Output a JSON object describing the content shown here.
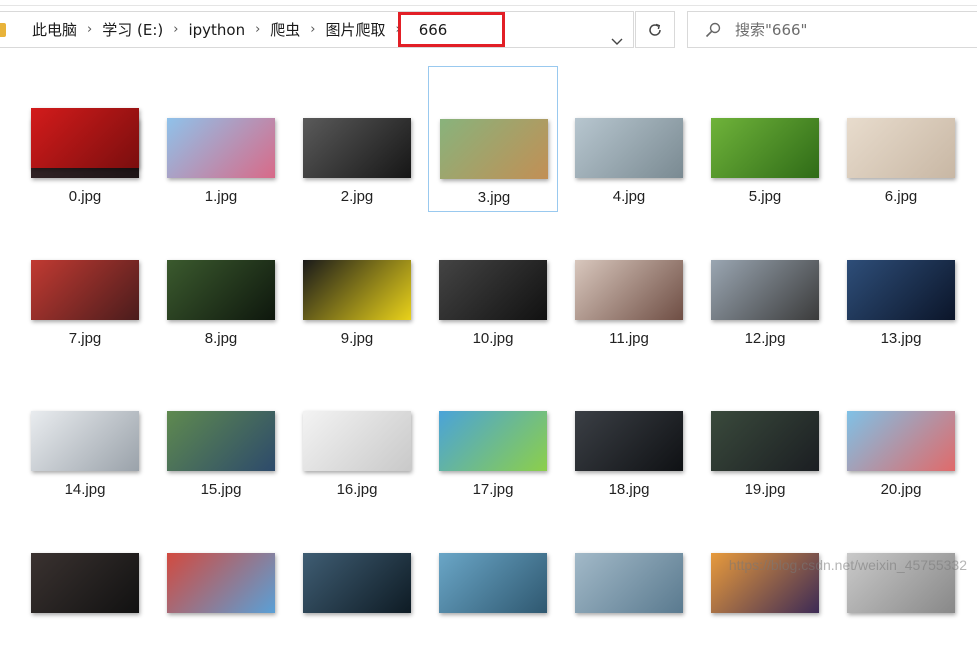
{
  "breadcrumb": {
    "items": [
      "此电脑",
      "学习 (E:)",
      "ipython",
      "爬虫",
      "图片爬取",
      "666"
    ]
  },
  "search": {
    "placeholder": "搜索\"666\""
  },
  "files": [
    {
      "name": "0.jpg",
      "colors": [
        "#3a2a2c",
        "#1d1416"
      ]
    },
    {
      "name": "1.jpg",
      "colors": [
        "#8fc2ea",
        "#d86a88"
      ]
    },
    {
      "name": "2.jpg",
      "colors": [
        "#5a5a5a",
        "#161616"
      ]
    },
    {
      "name": "3.jpg",
      "colors": [
        "#88b37c",
        "#c28f55"
      ]
    },
    {
      "name": "4.jpg",
      "colors": [
        "#b7c6cf",
        "#7a8a92"
      ]
    },
    {
      "name": "5.jpg",
      "colors": [
        "#6fb33a",
        "#2f6b17"
      ]
    },
    {
      "name": "6.jpg",
      "colors": [
        "#e8dccd",
        "#c8b7a4"
      ]
    },
    {
      "name": "7.jpg",
      "colors": [
        "#c13a32",
        "#4a1c1c"
      ]
    },
    {
      "name": "8.jpg",
      "colors": [
        "#3b5a2e",
        "#0e170d"
      ]
    },
    {
      "name": "9.jpg",
      "colors": [
        "#1a1a1a",
        "#e9d21a"
      ]
    },
    {
      "name": "10.jpg",
      "colors": [
        "#444",
        "#111"
      ]
    },
    {
      "name": "11.jpg",
      "colors": [
        "#d8c7bd",
        "#6f4e44"
      ]
    },
    {
      "name": "12.jpg",
      "colors": [
        "#9aa6b2",
        "#3b3b3b"
      ]
    },
    {
      "name": "13.jpg",
      "colors": [
        "#2e4e79",
        "#0b1529"
      ]
    },
    {
      "name": "14.jpg",
      "colors": [
        "#e9ecef",
        "#9aa2aa"
      ]
    },
    {
      "name": "15.jpg",
      "colors": [
        "#5f8a4f",
        "#2d4a6b"
      ]
    },
    {
      "name": "16.jpg",
      "colors": [
        "#f3f3f3",
        "#c9c9c9"
      ]
    },
    {
      "name": "17.jpg",
      "colors": [
        "#4aa3d9",
        "#8ccf4a"
      ]
    },
    {
      "name": "18.jpg",
      "colors": [
        "#3b3f45",
        "#0f1114"
      ]
    },
    {
      "name": "19.jpg",
      "colors": [
        "#3a4a3c",
        "#1b1e22"
      ]
    },
    {
      "name": "20.jpg",
      "colors": [
        "#7fc1e6",
        "#e06a6a"
      ]
    },
    {
      "name": "",
      "colors": [
        "#3a3230",
        "#111"
      ]
    },
    {
      "name": "",
      "colors": [
        "#d24a3f",
        "#5aa0d6"
      ]
    },
    {
      "name": "",
      "colors": [
        "#3f5d73",
        "#0e1b24"
      ]
    },
    {
      "name": "",
      "colors": [
        "#6aa6c7",
        "#2f5870"
      ]
    },
    {
      "name": "",
      "colors": [
        "#a2b9c8",
        "#5a7a8f"
      ]
    },
    {
      "name": "",
      "colors": [
        "#e79a3c",
        "#3d2a55"
      ]
    },
    {
      "name": "",
      "colors": [
        "#c9c9c9",
        "#888"
      ]
    },
    {
      "name": "",
      "colors": [
        "#d31b1b",
        "#7a0e0e"
      ]
    }
  ],
  "selected_file": "3.jpg",
  "watermark": "https://blog.csdn.net/weixin_45755332"
}
